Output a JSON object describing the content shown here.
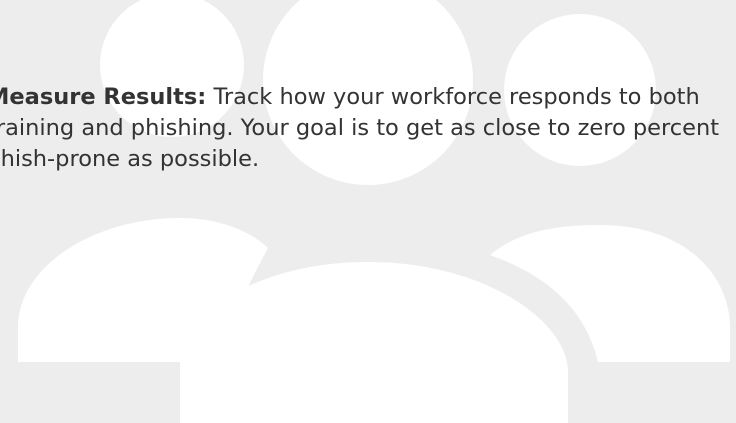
{
  "card": {
    "lead": "Measure Results:",
    "body": " Track how your workforce responds to both training and phishing. Your goal is to get as close to zero percent Phish-prone as possible."
  },
  "background": {
    "illustration": "people-group-icon",
    "colors": {
      "background": "#ededed",
      "figures": "#ffffff",
      "text": "#333333"
    }
  }
}
